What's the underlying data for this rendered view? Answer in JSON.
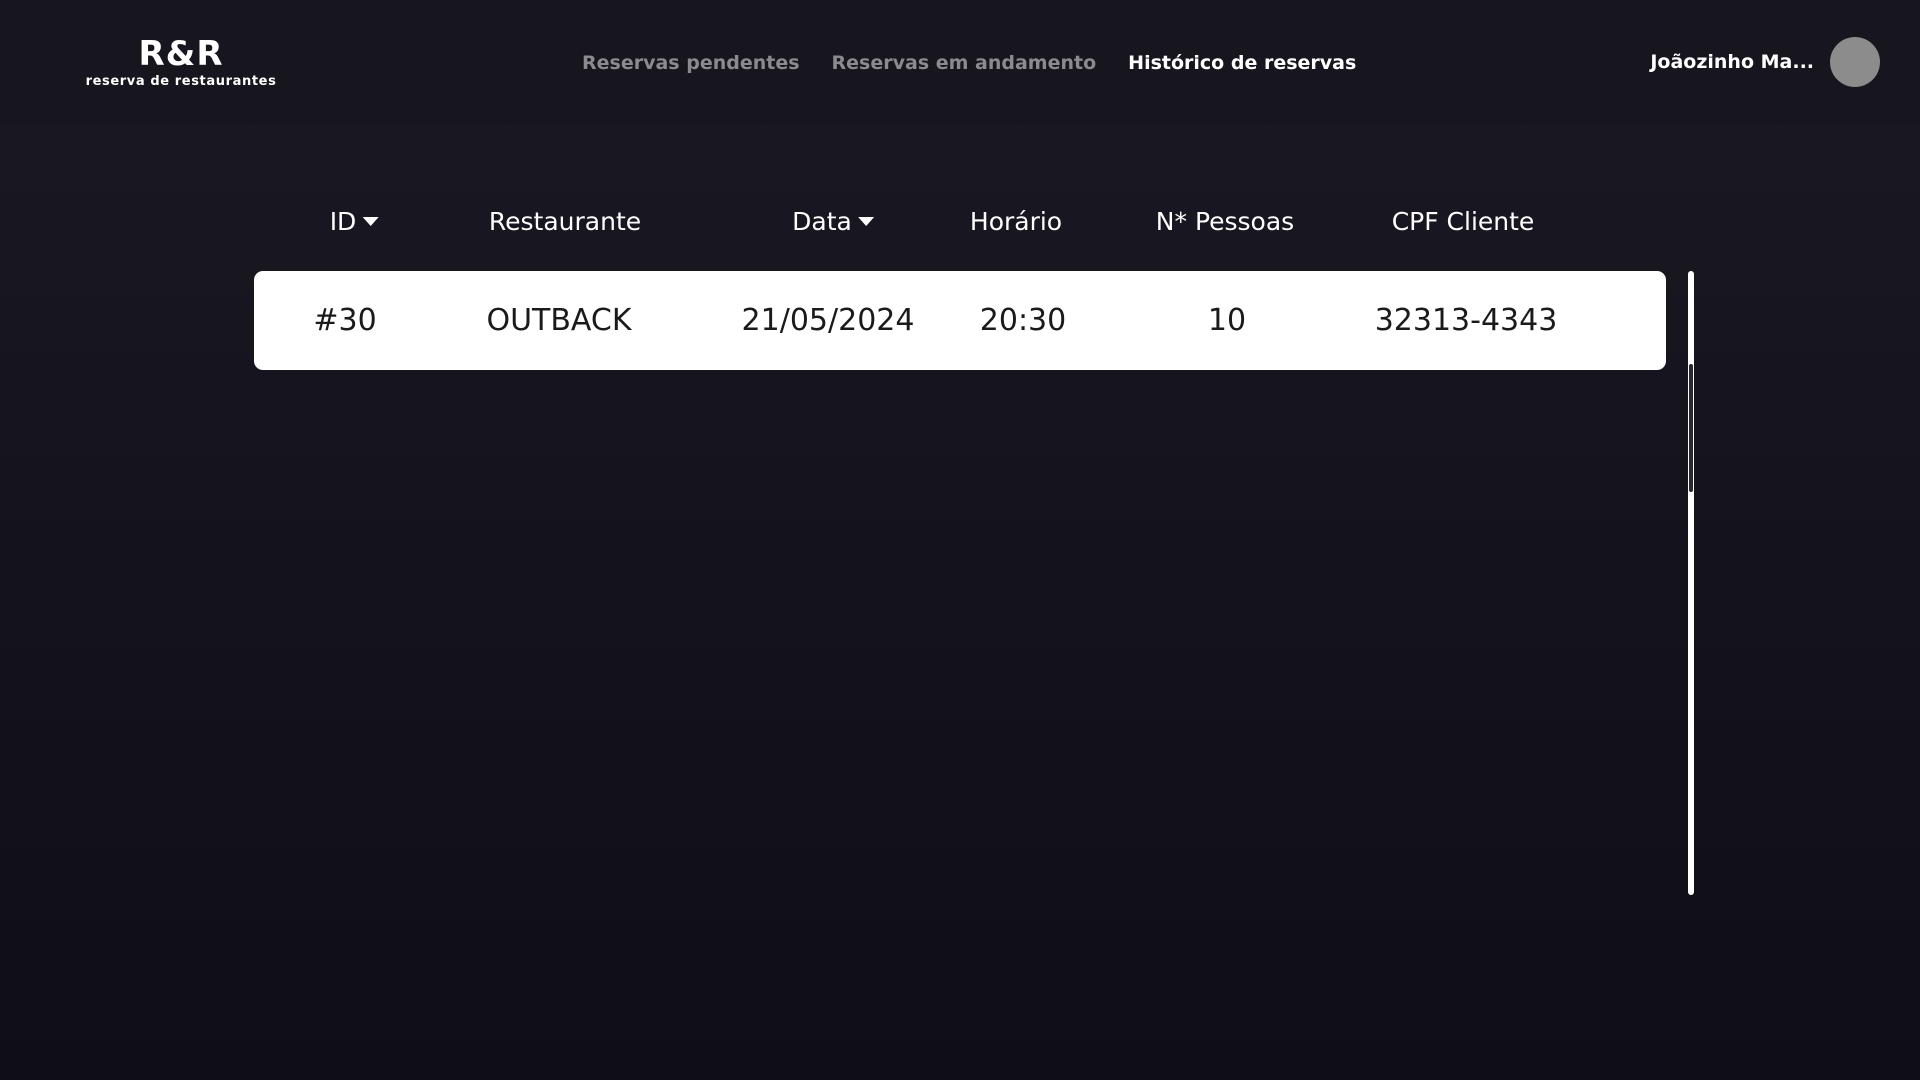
{
  "header": {
    "logo_title": "R&R",
    "logo_subtitle": "reserva de restaurantes",
    "nav": [
      {
        "label": "Reservas pendentes",
        "active": false
      },
      {
        "label": "Reservas em andamento",
        "active": false
      },
      {
        "label": "Histórico de reservas",
        "active": true
      }
    ],
    "user_name": "Joãozinho Ma..."
  },
  "table": {
    "columns": [
      "ID",
      "Restaurante",
      "Data",
      "Horário",
      "N* Pessoas",
      "CPF Cliente"
    ],
    "sortable_columns": [
      "ID",
      "Data"
    ],
    "rows": [
      {
        "id": "#30",
        "restaurant": "OUTBACK",
        "date": "21/05/2024",
        "time": "20:30",
        "people": "10",
        "cpf": "32313-4343"
      }
    ]
  },
  "colors": {
    "background": "#15131c",
    "header_background": "#17151e",
    "nav_inactive": "#8a8a90",
    "nav_active": "#ffffff",
    "row_background": "#ffffff",
    "row_text": "#1a1a1a",
    "avatar": "#8c8c8c"
  }
}
